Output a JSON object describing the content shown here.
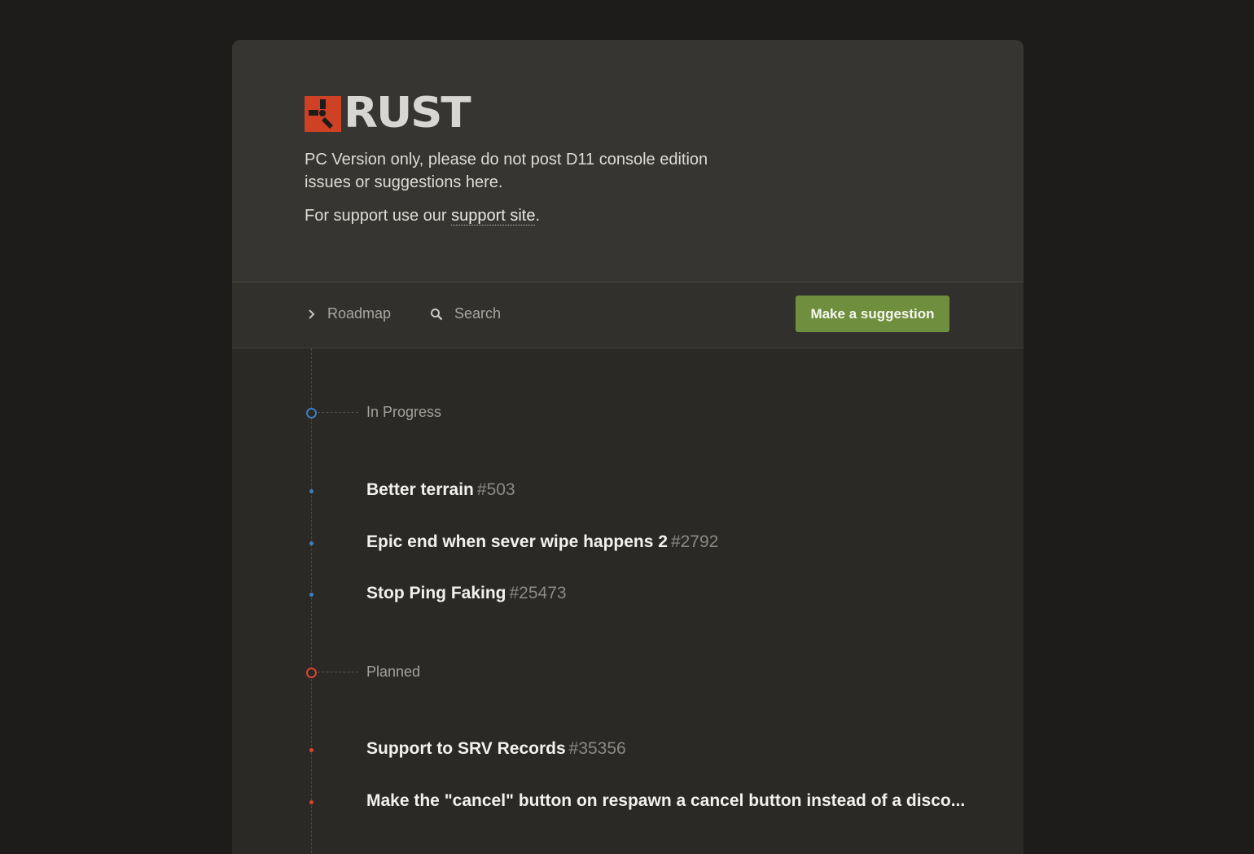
{
  "brand": {
    "name": "RUST",
    "accent": "#ce4125"
  },
  "hero": {
    "description": "PC Version only, please do not post D11 console edition issues or suggestions here.",
    "support_prefix": "For support use our ",
    "support_link": "support site",
    "support_suffix": "."
  },
  "toolbar": {
    "roadmap_label": "Roadmap",
    "search_label": "Search",
    "suggest_label": "Make a suggestion",
    "suggest_color": "#6f8f3e"
  },
  "sections": [
    {
      "status": "In Progress",
      "color": "#3d7fbf",
      "posts": [
        {
          "title": "Better terrain",
          "number": "#503"
        },
        {
          "title": "Epic end when sever wipe happens 2",
          "number": "#2792"
        },
        {
          "title": "Stop Ping Faking",
          "number": "#25473"
        }
      ]
    },
    {
      "status": "Planned",
      "color": "#d9452f",
      "posts": [
        {
          "title": "Support to SRV Records",
          "number": "#35356"
        },
        {
          "title": "Make the \"cancel\" button on respawn a cancel button instead of a disco...",
          "number": ""
        }
      ]
    }
  ]
}
